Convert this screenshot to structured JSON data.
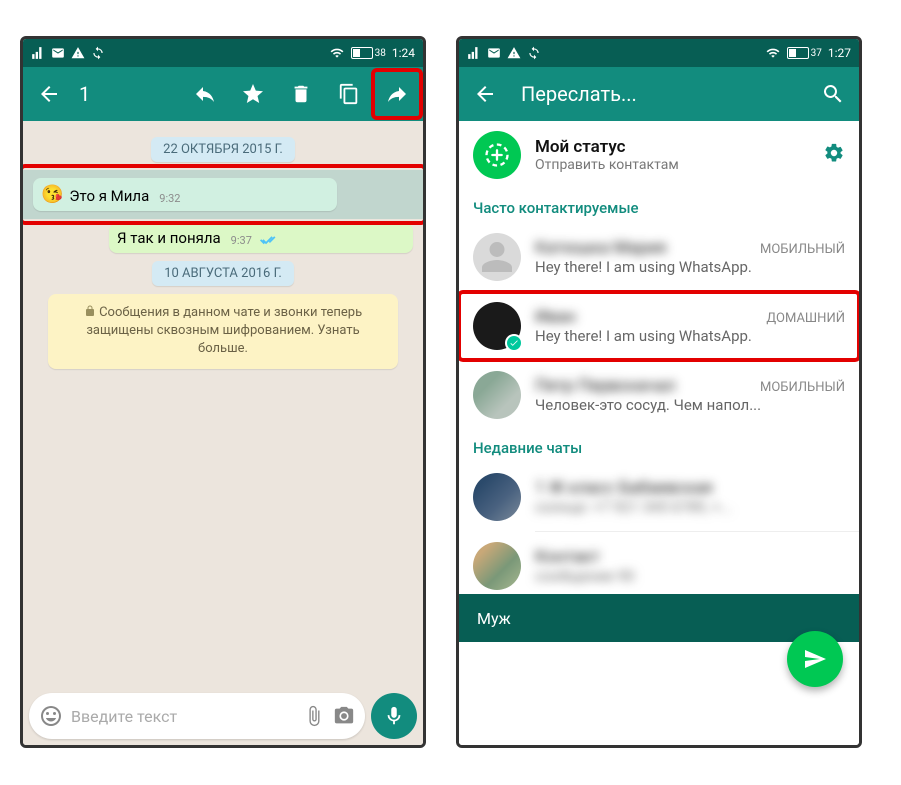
{
  "colors": {
    "primary": "#128c7e",
    "dark": "#075e54",
    "accent": "#00c853",
    "highlight": "#e30000"
  },
  "left": {
    "statusbar": {
      "battery": "38",
      "time": "1:24"
    },
    "header": {
      "count": "1"
    },
    "messages": {
      "date1": "22 ОКТЯБРЯ 2015 Г.",
      "msg1": {
        "text": "Это я Мила",
        "time": "9:32"
      },
      "msg2": {
        "text": "Я так и поняла",
        "time": "9:37"
      },
      "date2": "10 АВГУСТА 2016 Г.",
      "system": "Сообщения в данном чате и звонки теперь защищены сквозным шифрованием. Узнать больше."
    },
    "input": {
      "placeholder": "Введите текст"
    }
  },
  "right": {
    "statusbar": {
      "battery": "37",
      "time": "1:27"
    },
    "header": {
      "title": "Переслать..."
    },
    "status": {
      "title": "Мой статус",
      "subtitle": "Отправить контактам"
    },
    "sections": {
      "frequent": "Часто контактируемые",
      "recent": "Недавние чаты"
    },
    "contacts": [
      {
        "name": "Катюшка Мария",
        "tag": "МОБИЛЬНЫЙ",
        "sub": "Hey there! I am using WhatsApp."
      },
      {
        "name": "Иван",
        "tag": "ДОМАШНИЙ",
        "sub": "Hey there! I am using WhatsApp."
      },
      {
        "name": "Петр Первоначал",
        "tag": "МОБИЛЬНЫЙ",
        "sub": "Человек-это сосуд. Чем напол..."
      }
    ],
    "recent": [
      {
        "name": "1 Ж класс Бабаевская",
        "sub": "солнце: +7 921 345 6789, +..."
      },
      {
        "name": "Контакт",
        "sub": "сообщение 90"
      }
    ],
    "footer": "Муж"
  }
}
